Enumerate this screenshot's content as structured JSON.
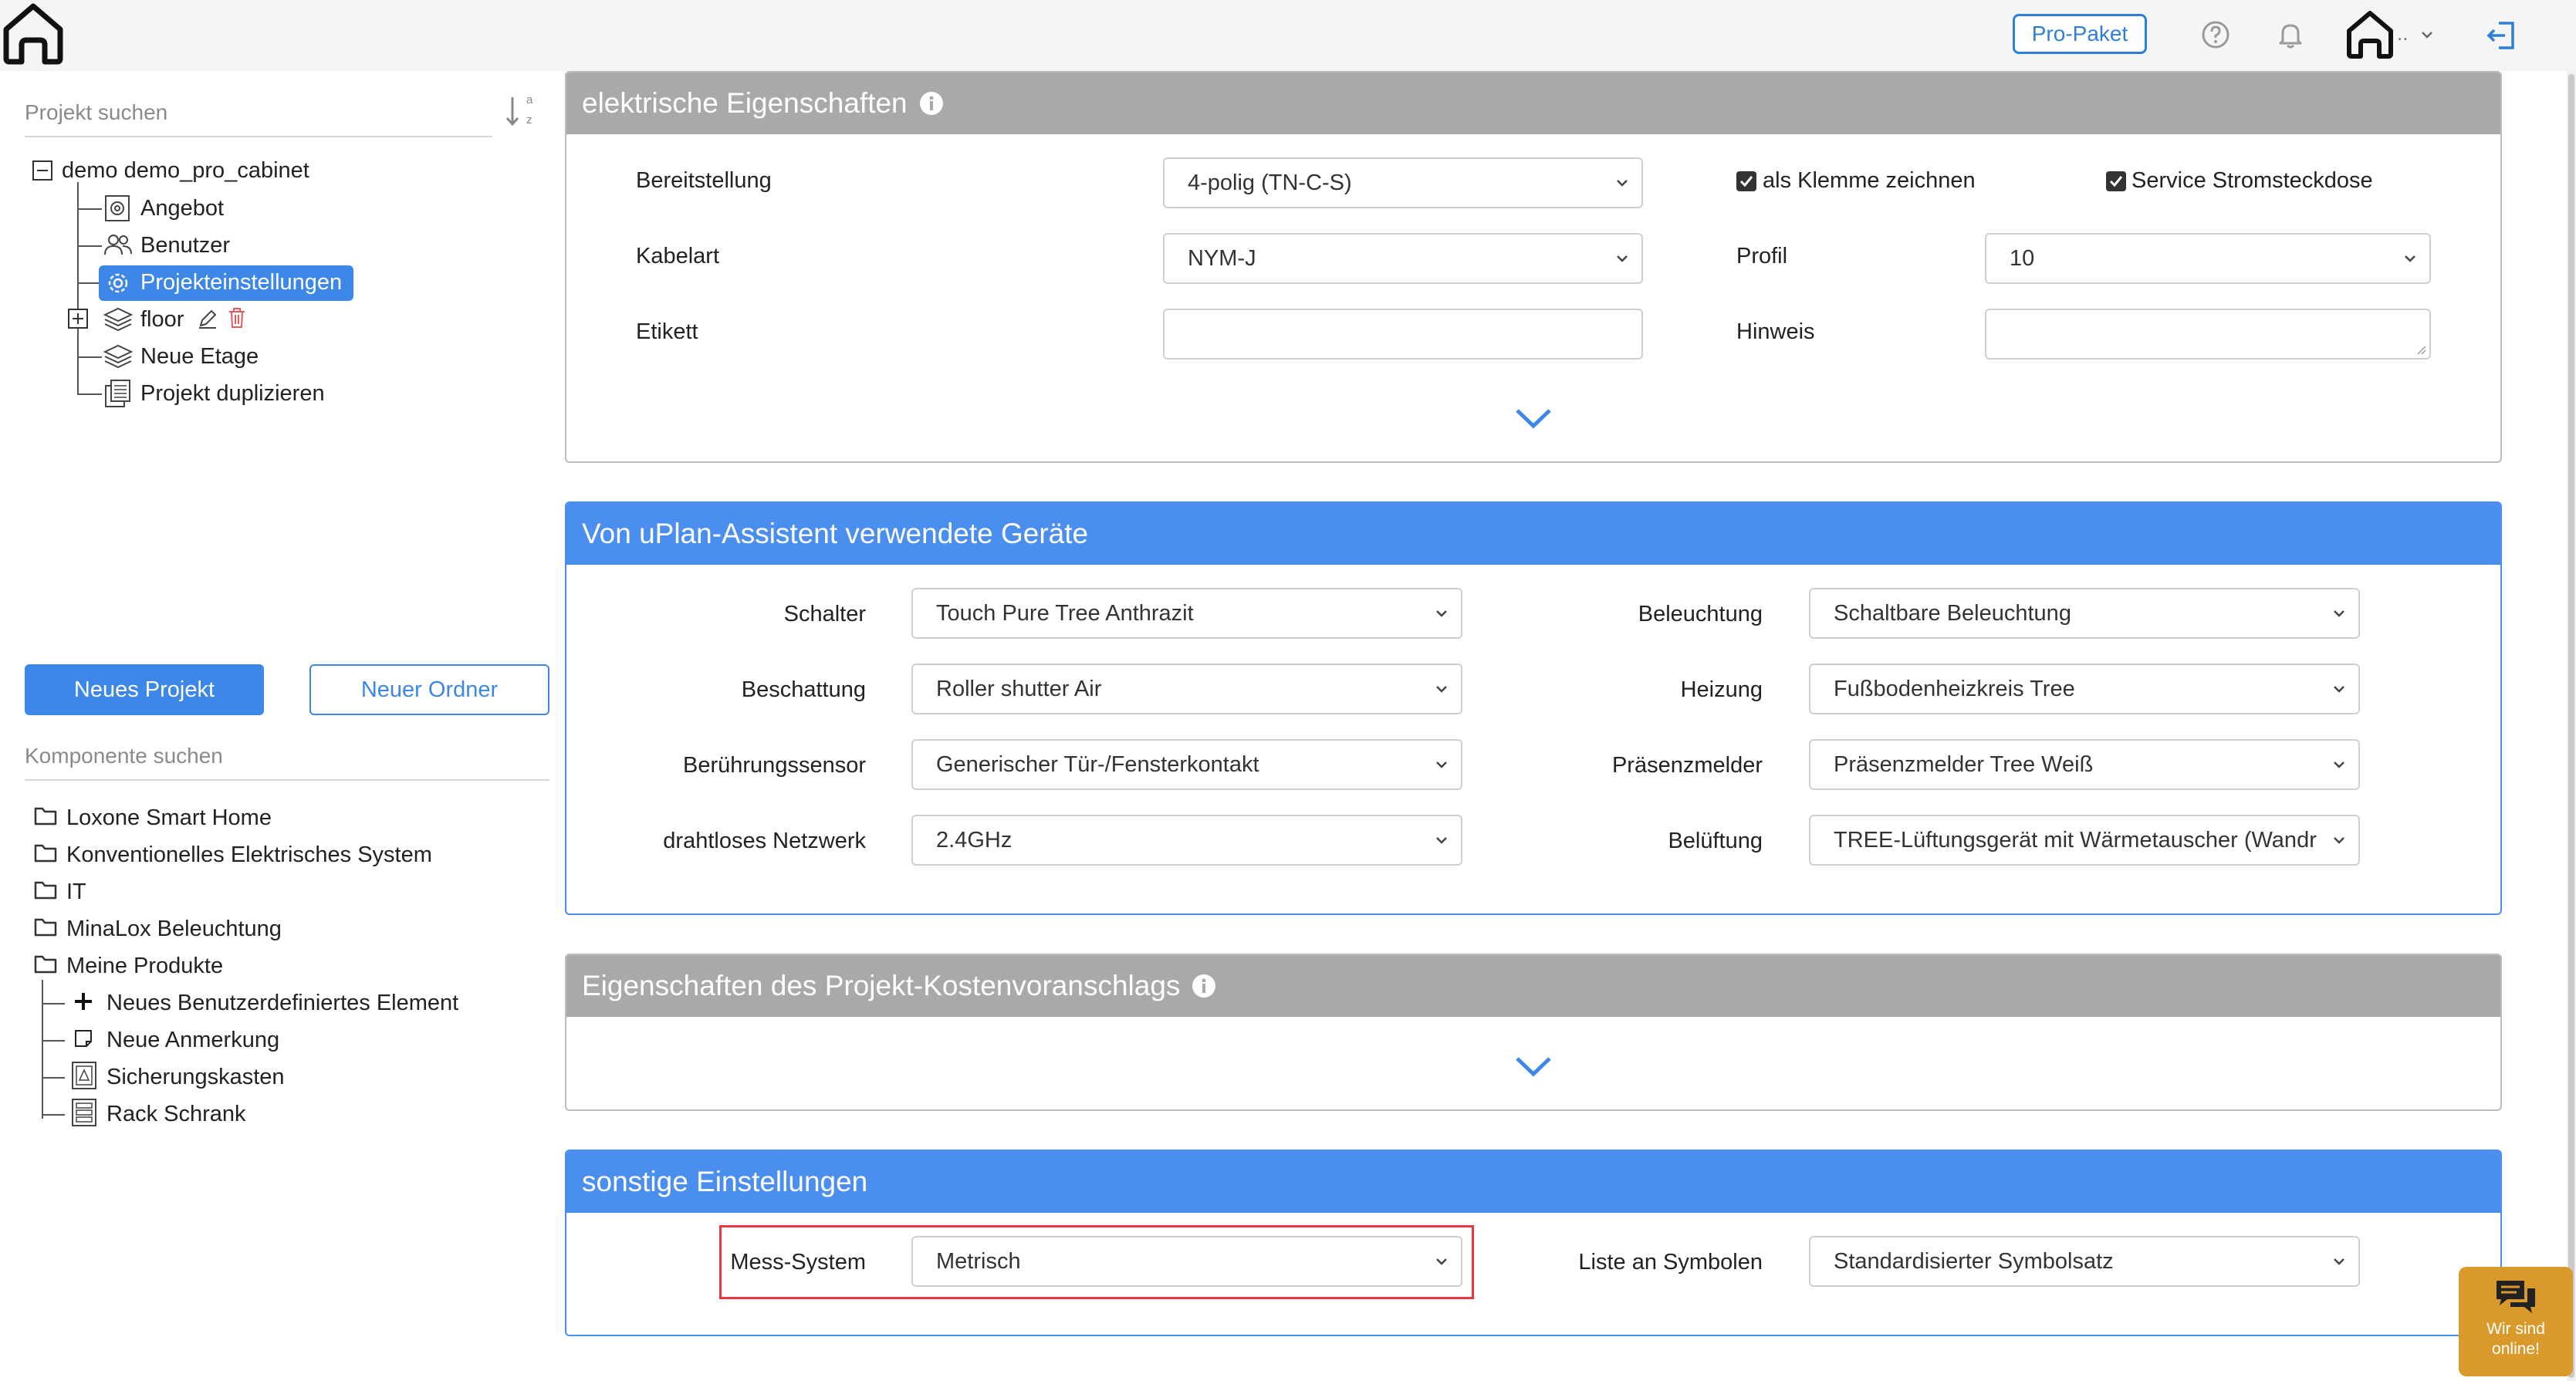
{
  "topbar": {
    "pro_label": "Pro-Paket",
    "user_dots": ".."
  },
  "sidebar": {
    "project_search_placeholder": "Projekt suchen",
    "sort_label": "a z",
    "project_tree": {
      "root": "demo demo_pro_cabinet",
      "items": [
        {
          "label": "Angebot",
          "icon": "gear-doc-icon"
        },
        {
          "label": "Benutzer",
          "icon": "users-icon"
        },
        {
          "label": "Projekteinstellungen",
          "icon": "gear-icon",
          "selected": true
        },
        {
          "label": "floor",
          "icon": "layers-icon"
        },
        {
          "label": "Neue Etage",
          "icon": "layers-plus-icon"
        },
        {
          "label": "Projekt duplizieren",
          "icon": "copy-icon"
        }
      ]
    },
    "new_project_label": "Neues Projekt",
    "new_folder_label": "Neuer Ordner",
    "component_search_placeholder": "Komponente suchen",
    "component_tree": {
      "folders": [
        "Loxone Smart Home",
        "Konventionelles Elektrisches System",
        "IT",
        "MinaLox Beleuchtung",
        "Meine Produkte"
      ],
      "children": [
        {
          "label": "Neues Benutzerdefiniertes Element",
          "icon": "plus-icon"
        },
        {
          "label": "Neue Anmerkung",
          "icon": "note-icon"
        },
        {
          "label": "Sicherungskasten",
          "icon": "fusebox-icon"
        },
        {
          "label": "Rack Schrank",
          "icon": "rack-icon"
        }
      ]
    }
  },
  "electrical": {
    "title": "elektrische Eigenschaften",
    "bereitstellung_label": "Bereitstellung",
    "bereitstellung_value": "4-polig (TN-C-S)",
    "kabelart_label": "Kabelart",
    "kabelart_value": "NYM-J",
    "etikett_label": "Etikett",
    "etikett_value": "",
    "klemme_label": "als Klemme zeichnen",
    "klemme_checked": true,
    "service_label": "Service Stromsteckdose",
    "service_checked": true,
    "profil_label": "Profil",
    "profil_value": "10",
    "hinweis_label": "Hinweis",
    "hinweis_value": ""
  },
  "devices": {
    "title": "Von uPlan-Assistent verwendete Geräte",
    "rows_left": [
      {
        "label": "Schalter",
        "value": "Touch Pure Tree Anthrazit"
      },
      {
        "label": "Beschattung",
        "value": "Roller shutter Air"
      },
      {
        "label": "Berührungssensor",
        "value": "Generischer Tür-/Fensterkontakt"
      },
      {
        "label": "drahtloses Netzwerk",
        "value": "2.4GHz"
      }
    ],
    "rows_right": [
      {
        "label": "Beleuchtung",
        "value": "Schaltbare Beleuchtung"
      },
      {
        "label": "Heizung",
        "value": "Fußbodenheizkreis Tree"
      },
      {
        "label": "Präsenzmelder",
        "value": "Präsenzmelder Tree Weiß"
      },
      {
        "label": "Belüftung",
        "value": "TREE-Lüftungsgerät mit Wärmetauscher (Wandr"
      }
    ]
  },
  "cost": {
    "title": "Eigenschaften des Projekt-Kostenvoranschlags"
  },
  "misc": {
    "title": "sonstige Einstellungen",
    "mess_label": "Mess-System",
    "mess_value": "Metrisch",
    "symbol_label": "Liste an Symbolen",
    "symbol_value": "Standardisierter Symbolsatz"
  },
  "chat": {
    "line1": "Wir sind",
    "line2": "online!"
  },
  "colors": {
    "accent": "#3d87e8",
    "gray_header": "#a9a9a9",
    "highlight": "#e8383d",
    "chat": "#d99a2b"
  }
}
